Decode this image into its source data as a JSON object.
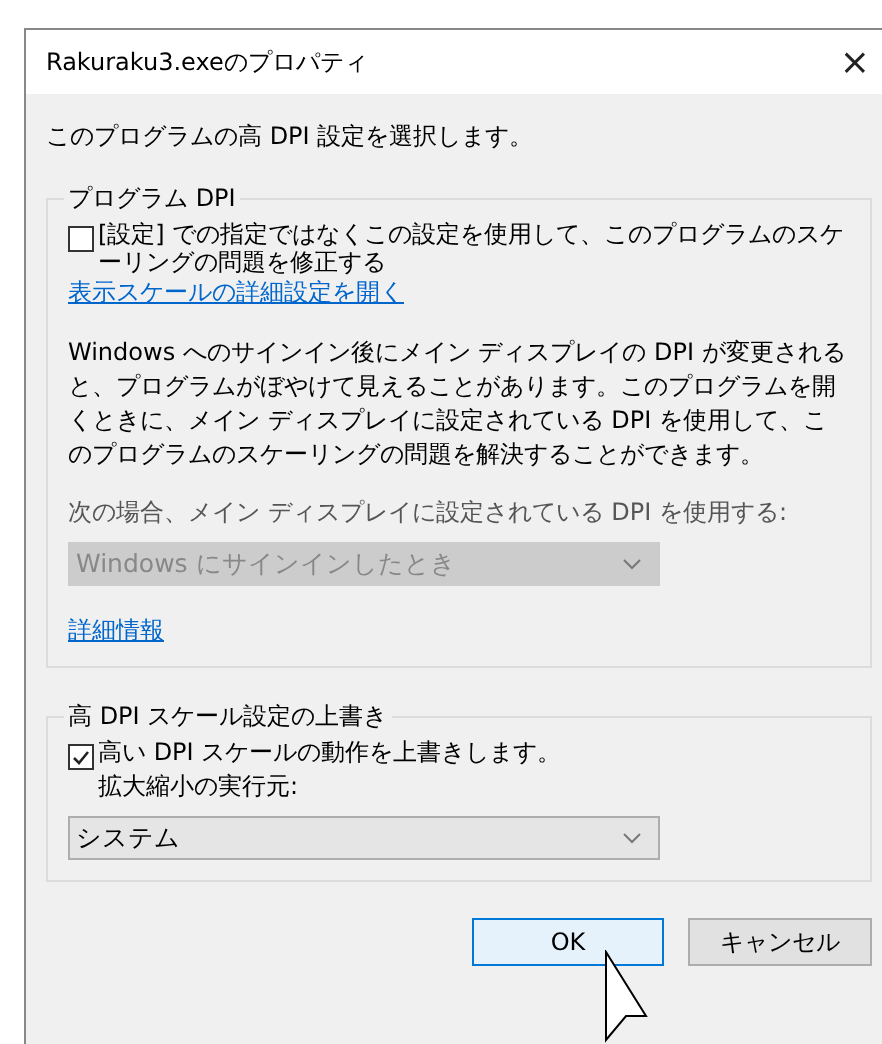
{
  "window": {
    "title": "Rakuraku3.exeのプロパティ",
    "close": "×"
  },
  "heading": "このプログラムの高 DPI 設定を選択します。",
  "program_dpi": {
    "legend": "プログラム DPI",
    "checkbox": {
      "label": "[設定] での指定ではなくこの設定を使用して、このプログラムのスケーリングの問題を修正する",
      "checked": false
    },
    "link": "表示スケールの詳細設定を開く",
    "description": "Windows へのサインイン後にメイン ディスプレイの DPI が変更されると、プログラムがぼやけて見えることがあります。このプログラムを開くときに、メイン ディスプレイに設定されている DPI を使用して、このプログラムのスケーリングの問題を解決することができます。",
    "select_label": "次の場合、メイン ディスプレイに設定されている DPI を使用する:",
    "select": {
      "value": "Windows にサインインしたとき",
      "disabled": true
    },
    "more_link": "詳細情報"
  },
  "override": {
    "legend": "高 DPI スケール設定の上書き",
    "checkbox": {
      "label": "高い DPI スケールの動作を上書きします。",
      "checked": true
    },
    "sub_label": "拡大縮小の実行元:",
    "select": {
      "value": "システム",
      "disabled": false
    }
  },
  "buttons": [
    {
      "label": "OK",
      "selected": true
    },
    {
      "label": "キャンセル",
      "selected": false
    }
  ]
}
